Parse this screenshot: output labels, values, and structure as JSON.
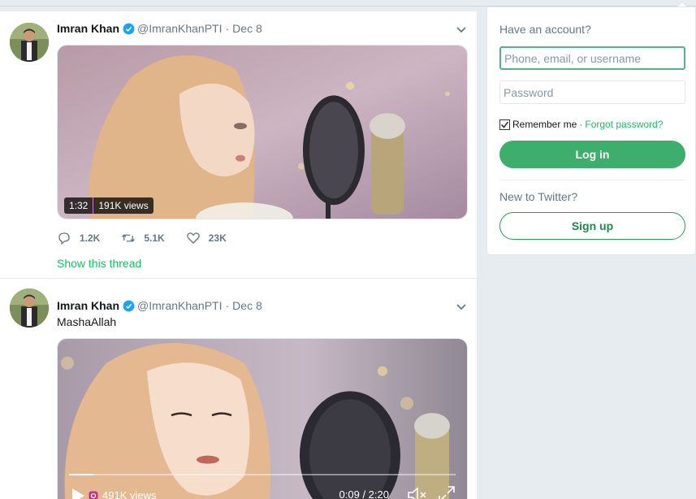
{
  "tweets": [
    {
      "name": "Imran Khan",
      "handle": "@ImranKhanPTI",
      "separator": "·",
      "date": "Dec 8",
      "text": "",
      "video": {
        "duration": "1:32",
        "views": "191K views"
      },
      "stats": {
        "replies": "1.2K",
        "retweets": "5.1K",
        "likes": "23K"
      },
      "show_thread": "Show this thread"
    },
    {
      "name": "Imran Khan",
      "handle": "@ImranKhanPTI",
      "separator": "·",
      "date": "Dec 8",
      "text": "MashaAllah",
      "video": {
        "views": "491K views",
        "time": "0:09 / 2:20",
        "progress_fraction": 0.064
      }
    }
  ],
  "login": {
    "have_account": "Have an account?",
    "username_placeholder": "Phone, email, or username",
    "password_placeholder": "Password",
    "remember_me": "Remember me",
    "separator": "·",
    "forgot_password": "Forgot password?",
    "login_button": "Log in",
    "new_to_twitter": "New to Twitter?",
    "signup_button": "Sign up"
  },
  "colors": {
    "accent_green": "#17bf63",
    "login_button": "#3dae6b",
    "verified_blue": "#1da1f2",
    "secondary_text": "#657786"
  },
  "icons": [
    "verified-badge-icon",
    "chevron-down-icon",
    "reply-icon",
    "retweet-icon",
    "like-icon",
    "play-icon",
    "instagram-icon",
    "mute-icon",
    "fullscreen-icon",
    "checkbox-checked-icon"
  ]
}
